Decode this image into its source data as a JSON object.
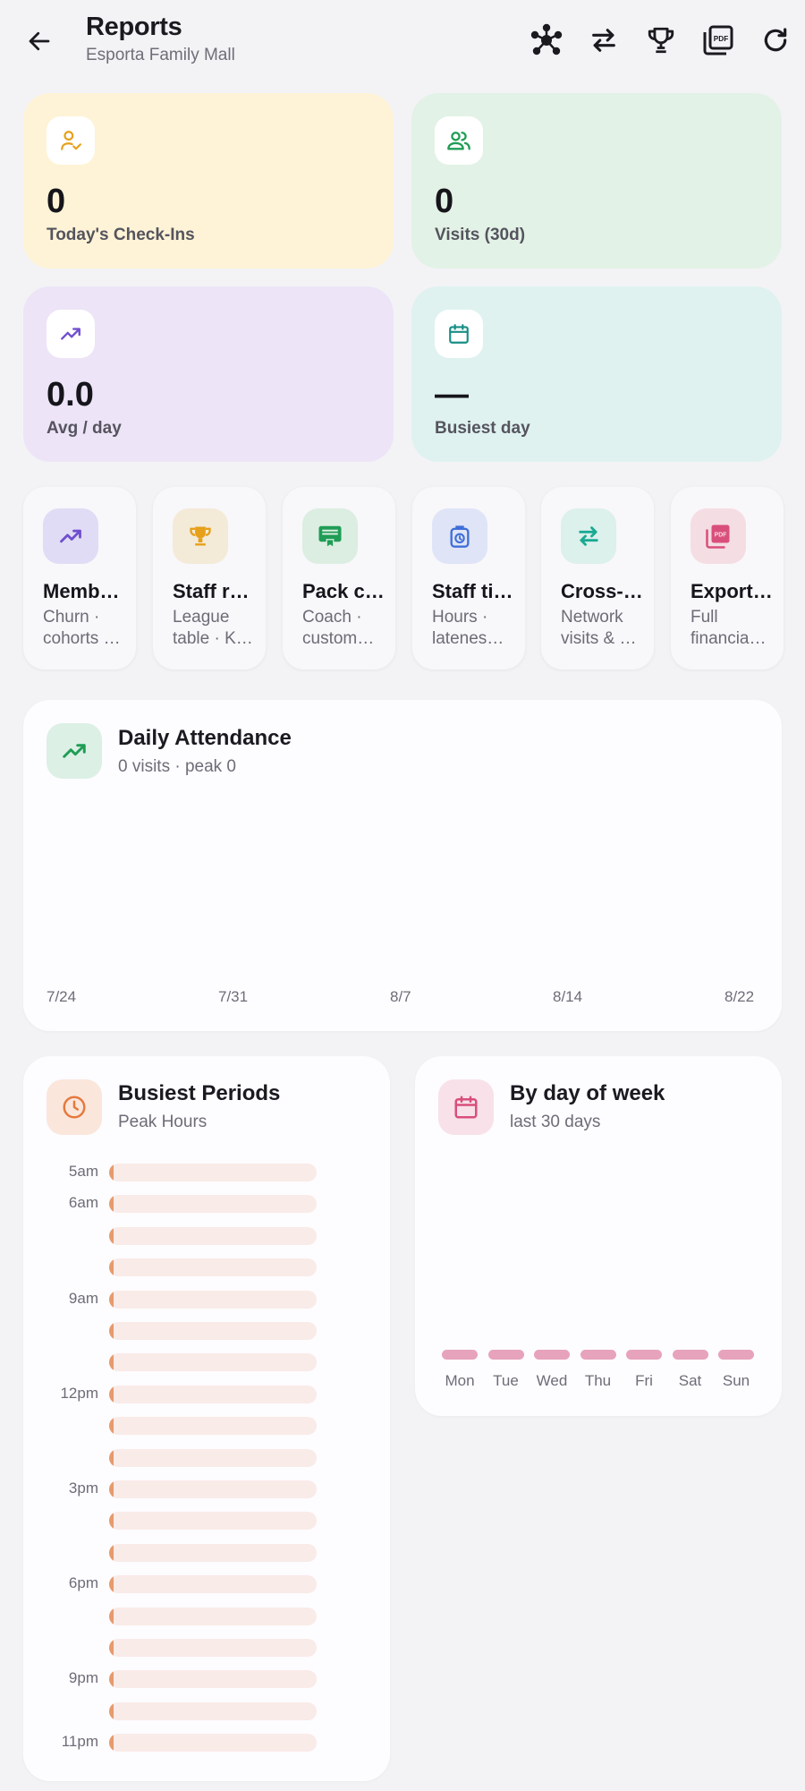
{
  "header": {
    "title": "Reports",
    "subtitle": "Esporta Family Mall",
    "icons": [
      "back-arrow-icon",
      "network-icon",
      "swap-icon",
      "trophy-icon",
      "pdf-icon",
      "refresh-icon"
    ]
  },
  "stats": [
    {
      "value": "0",
      "label": "Today's Check-Ins",
      "icon": "user-check-icon",
      "bg": "#fef3d6",
      "accent": "#e6a019"
    },
    {
      "value": "0",
      "label": "Visits (30d)",
      "icon": "users-icon",
      "bg": "#e3f2e6",
      "accent": "#1f9d55"
    },
    {
      "value": "0.0",
      "label": "Avg / day",
      "icon": "trend-up-icon",
      "bg": "#ede4f7",
      "accent": "#6f4fcf"
    },
    {
      "value": "—",
      "label": "Busiest day",
      "icon": "calendar-icon",
      "bg": "#dff2f0",
      "accent": "#178f86"
    }
  ],
  "tiles": [
    {
      "title": "Memb…",
      "line1": "Churn ·",
      "line2": "cohorts …",
      "icon": "trend-up-icon",
      "bg": "#e1dcf5",
      "accent": "#6f4fcf"
    },
    {
      "title": "Staff r…",
      "line1": "League",
      "line2": "table · K…",
      "icon": "trophy-icon",
      "bg": "#f4ead8",
      "accent": "#e6a019"
    },
    {
      "title": "Pack c…",
      "line1": "Coach ·",
      "line2": "custom…",
      "icon": "certificate-icon",
      "bg": "#dbeee1",
      "accent": "#1f9d55"
    },
    {
      "title": "Staff ti…",
      "line1": "Hours ·",
      "line2": "latenes…",
      "icon": "timer-icon",
      "bg": "#dfe4f7",
      "accent": "#3f6fd8"
    },
    {
      "title": "Cross-l…",
      "line1": "Network",
      "line2": "visits & …",
      "icon": "swap-icon",
      "bg": "#dcf0ec",
      "accent": "#1aaa92"
    },
    {
      "title": "Export …",
      "line1": "Full",
      "line2": "financia…",
      "icon": "pdf-icon",
      "bg": "#f5dde4",
      "accent": "#d94f7b"
    }
  ],
  "attendance": {
    "title": "Daily Attendance",
    "subtitle": "0 visits · peak 0",
    "ticks": [
      "7/24",
      "7/31",
      "8/7",
      "8/14",
      "8/22"
    ]
  },
  "busiest": {
    "title": "Busiest Periods",
    "subtitle": "Peak Hours",
    "rows": [
      {
        "label": "5am",
        "value": 0
      },
      {
        "label": "6am",
        "value": 0
      },
      {
        "label": "",
        "value": 0
      },
      {
        "label": "",
        "value": 0
      },
      {
        "label": "9am",
        "value": 0
      },
      {
        "label": "",
        "value": 0
      },
      {
        "label": "",
        "value": 0
      },
      {
        "label": "12pm",
        "value": 0
      },
      {
        "label": "",
        "value": 0
      },
      {
        "label": "",
        "value": 0
      },
      {
        "label": "3pm",
        "value": 0
      },
      {
        "label": "",
        "value": 0
      },
      {
        "label": "",
        "value": 0
      },
      {
        "label": "6pm",
        "value": 0
      },
      {
        "label": "",
        "value": 0
      },
      {
        "label": "",
        "value": 0
      },
      {
        "label": "9pm",
        "value": 0
      },
      {
        "label": "",
        "value": 0
      },
      {
        "label": "11pm",
        "value": 0
      }
    ]
  },
  "dow": {
    "title": "By day of week",
    "subtitle": "last 30 days",
    "days": [
      {
        "label": "Mon",
        "value": 0
      },
      {
        "label": "Tue",
        "value": 0
      },
      {
        "label": "Wed",
        "value": 0
      },
      {
        "label": "Thu",
        "value": 0
      },
      {
        "label": "Fri",
        "value": 0
      },
      {
        "label": "Sat",
        "value": 0
      },
      {
        "label": "Sun",
        "value": 0
      }
    ]
  }
}
